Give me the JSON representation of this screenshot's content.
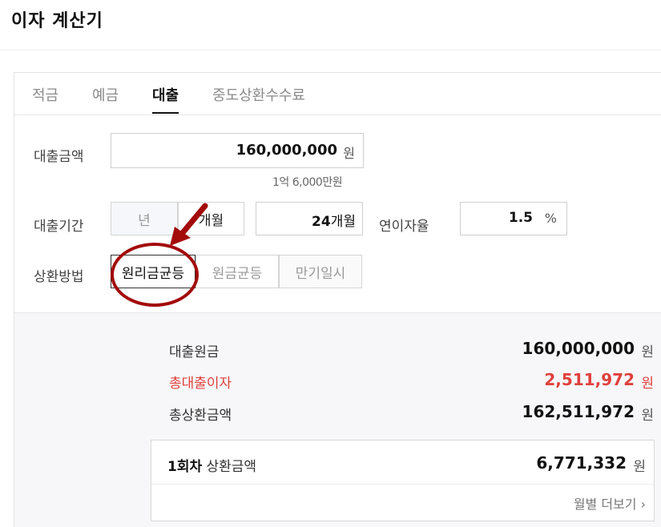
{
  "page": {
    "title": "이자 계산기"
  },
  "tabs": [
    {
      "label": "적금",
      "active": false
    },
    {
      "label": "예금",
      "active": false
    },
    {
      "label": "대출",
      "active": true
    },
    {
      "label": "중도상환수수료",
      "active": false
    }
  ],
  "form": {
    "amount": {
      "label": "대출금액",
      "value": "160,000,000",
      "unit": "원",
      "hint": "1억 6,000만원"
    },
    "period": {
      "label": "대출기간",
      "year_option": "년",
      "month_option": "개월",
      "value": "24",
      "unit": "개월"
    },
    "rate": {
      "label": "연이자율",
      "value": "1.5",
      "unit": "%"
    },
    "method": {
      "label": "상환방법",
      "options": [
        "원리금균등",
        "원금균등",
        "만기일시"
      ],
      "selected": "원리금균등"
    }
  },
  "result": {
    "principal": {
      "label": "대출원금",
      "value": "160,000,000",
      "unit": "원"
    },
    "interest": {
      "label": "총대출이자",
      "value": "2,511,972",
      "unit": "원",
      "color": "#e0403c"
    },
    "total": {
      "label": "총상환금액",
      "value": "162,511,972",
      "unit": "원"
    },
    "installment": {
      "label_bold": "1회차",
      "label_rest": "상환금액",
      "value": "6,771,332",
      "unit": "원"
    },
    "more_link": "월별 더보기"
  },
  "annotation": {
    "color": "#a30b0b"
  }
}
